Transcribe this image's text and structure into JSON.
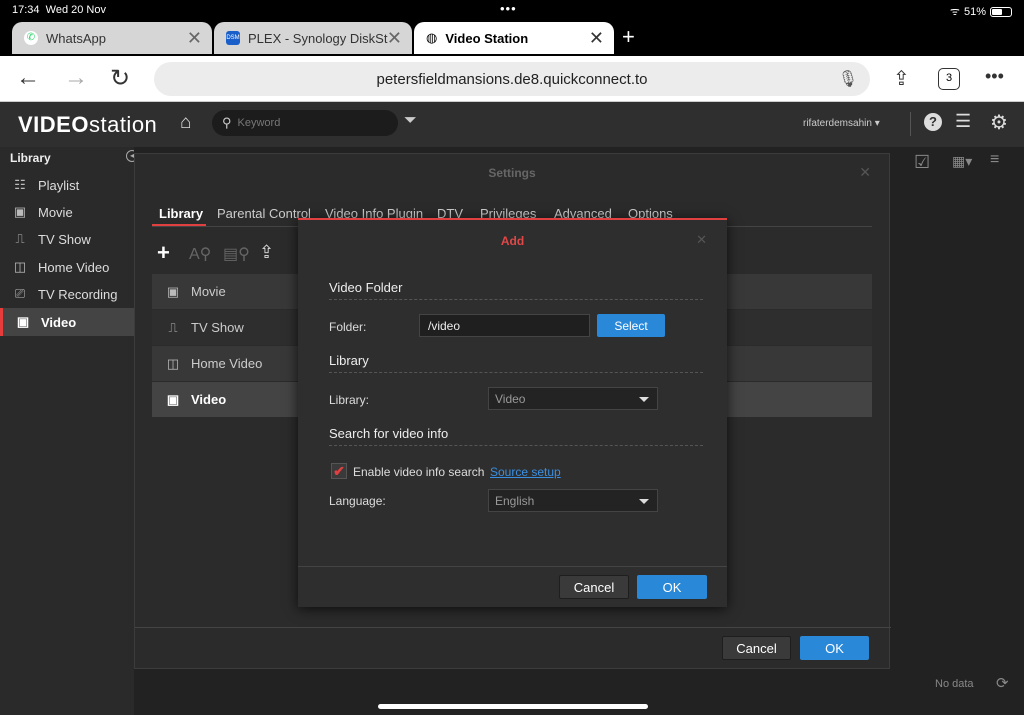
{
  "status": {
    "time": "17:34",
    "date": "Wed 20 Nov",
    "dots": "•••",
    "battery": "51%"
  },
  "browser_tabs": [
    {
      "label": "WhatsApp"
    },
    {
      "label": "PLEX - Synology DiskSta"
    },
    {
      "label": "Video Station"
    }
  ],
  "address": {
    "url": "petersfieldmansions.de8.quickconnect.to",
    "tab_count": "3",
    "more": "•••"
  },
  "app": {
    "logo_prefix": "VIDEO",
    "logo_suffix": "station",
    "search_placeholder": "Keyword",
    "username": "rifaterdemsahin ▾"
  },
  "sidebar": {
    "heading": "Library",
    "items": [
      {
        "label": "Playlist"
      },
      {
        "label": "Movie"
      },
      {
        "label": "TV Show"
      },
      {
        "label": "Home Video"
      },
      {
        "label": "TV Recording"
      },
      {
        "label": "Video"
      }
    ]
  },
  "settings": {
    "title": "Settings",
    "tabs": [
      {
        "label": "Library"
      },
      {
        "label": "Parental Control"
      },
      {
        "label": "Video Info Plugin"
      },
      {
        "label": "DTV"
      },
      {
        "label": "Privileges"
      },
      {
        "label": "Advanced"
      },
      {
        "label": "Options"
      }
    ],
    "libraries": [
      {
        "label": "Movie"
      },
      {
        "label": "TV Show"
      },
      {
        "label": "Home Video"
      },
      {
        "label": "Video"
      }
    ],
    "cancel": "Cancel",
    "ok": "OK"
  },
  "add": {
    "title": "Add",
    "video_folder_heading": "Video Folder",
    "folder_label": "Folder:",
    "folder_value": "/video",
    "select_btn": "Select",
    "library_heading": "Library",
    "library_label": "Library:",
    "library_value": "Video",
    "search_heading": "Search for video info",
    "enable_label": "Enable video info search",
    "source_link": "Source setup",
    "language_label": "Language:",
    "language_value": "English",
    "cancel": "Cancel",
    "ok": "OK"
  },
  "footer": {
    "no_data": "No data"
  }
}
